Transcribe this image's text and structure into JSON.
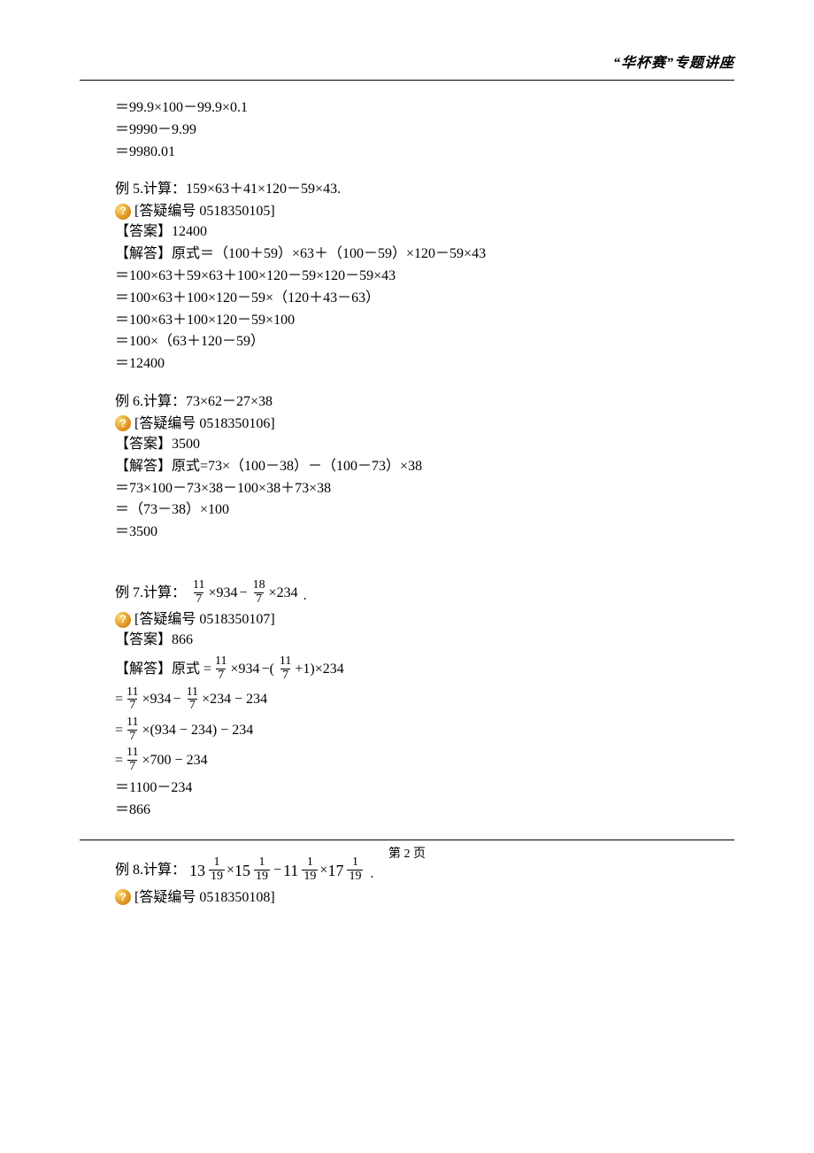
{
  "header": {
    "right": "“华杯赛”专题讲座"
  },
  "intro": {
    "l1": "＝99.9×100－99.9×0.1",
    "l2": "＝9990－9.99",
    "l3": "＝9980.01"
  },
  "ex5": {
    "title": "例 5.计算：159×63＋41×120－59×43.",
    "qr": "[答疑编号 0518350105]",
    "ans": "【答案】12400",
    "s1": "【解答】原式＝（100＋59）×63＋（100－59）×120－59×43",
    "s2": "＝100×63＋59×63＋100×120－59×120－59×43",
    "s3": "＝100×63＋100×120－59×（120＋43－63）",
    "s4": "＝100×63＋100×120－59×100",
    "s5": "＝100×（63＋120－59）",
    "s6": "＝12400"
  },
  "ex6": {
    "title": "例 6.计算：73×62－27×38",
    "qr": "[答疑编号 0518350106]",
    "ans": "【答案】3500",
    "s1": "【解答】原式=73×（100－38）－（100－73）×38",
    "s2": "＝73×100－73×38－100×38＋73×38",
    "s3": "＝（73－38）×100",
    "s4": "＝3500"
  },
  "ex7": {
    "prefix": "例 7.计算：",
    "f1n": "11",
    "f1d": "7",
    "mul934": "×934",
    "minus": "−",
    "f2n": "18",
    "f2d": "7",
    "mul234": "×234",
    "dot": ".",
    "qr": "[答疑编号 0518350107]",
    "ans": "【答案】866",
    "solprefix": "【解答】原式",
    "eq": "=",
    "f11n": "11",
    "f11d": "7",
    "t_934": "×934",
    "lp": "−(",
    "plus1": "+1)",
    "t_234": "×234",
    "e1_tail": "×234 − 234",
    "e2_mid": "×(934 − 234) − 234",
    "e3_mid": "×700 − 234",
    "e4": "＝1100－234",
    "e5": "＝866"
  },
  "ex8": {
    "prefix": "例 8.计算：",
    "w13": "13",
    "w15": "15",
    "w11": "11",
    "w17": "17",
    "n1": "1",
    "d19": "19",
    "times": "×",
    "minus": "−",
    "dot": ".",
    "qr": "[答疑编号 0518350108]"
  },
  "footer": {
    "page": "第 2 页"
  }
}
